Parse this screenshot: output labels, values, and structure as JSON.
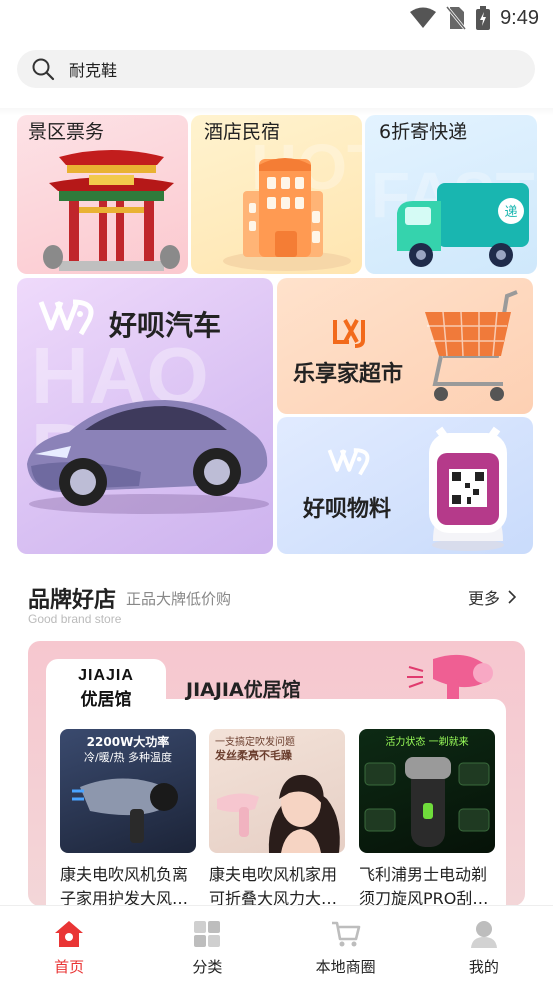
{
  "status_bar": {
    "time": "9:49"
  },
  "search": {
    "query": "耐克鞋"
  },
  "tiles": {
    "scenic": {
      "label": "景区票务"
    },
    "hotel": {
      "label": "酒店民宿",
      "bg_text": "HOT"
    },
    "express": {
      "label": "6折寄快递",
      "bg_text": "FAST"
    },
    "auto": {
      "label": "好呗汽车",
      "bg_text": "HAO BEI"
    },
    "supermarket": {
      "label": "乐享家超市"
    },
    "supplies": {
      "label": "好呗物料"
    }
  },
  "brand_section": {
    "title": "品牌好店",
    "subtitle": "正品大牌低价购",
    "subtitle_en": "Good brand store",
    "more_label": "更多"
  },
  "brand_store": {
    "logo_en": "JIAJIA",
    "logo_cn": "优居馆",
    "name": "JIAJIA优居馆",
    "products": [
      {
        "title": "康夫电吹风机负离子家用护发大风…",
        "badge_line1": "2200W大功率",
        "badge_line2": "冷/暖/热 多种温度"
      },
      {
        "title": "康夫电吹风机家用可折叠大风力大…",
        "badge_line1": "一支搞定吹发问题",
        "badge_line2": "发丝柔亮不毛躁"
      },
      {
        "title": "飞利浦男士电动剃须刀旋风PRO刮…",
        "badge_line1": "活力状态 一剃就来"
      }
    ]
  },
  "bottom_nav": [
    {
      "label": "首页",
      "icon": "home-icon",
      "active": true
    },
    {
      "label": "分类",
      "icon": "category-icon",
      "active": false
    },
    {
      "label": "本地商圈",
      "icon": "cart-icon",
      "active": false
    },
    {
      "label": "我的",
      "icon": "profile-icon",
      "active": false
    }
  ],
  "colors": {
    "accent": "#e93535",
    "text": "#222222",
    "muted": "#888888"
  }
}
